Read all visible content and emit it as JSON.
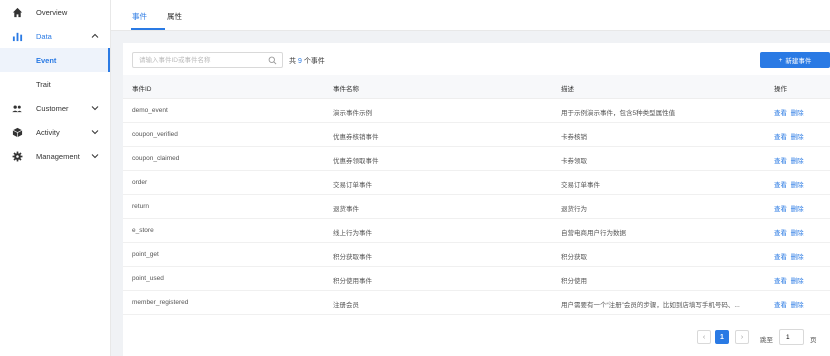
{
  "sidebar": {
    "items": [
      {
        "label": "Overview",
        "icon": "home-icon"
      },
      {
        "label": "Data",
        "icon": "bar-chart-icon",
        "expanded": true,
        "children": [
          {
            "label": "Event",
            "active": true
          },
          {
            "label": "Trait"
          }
        ]
      },
      {
        "label": "Customer",
        "icon": "users-icon"
      },
      {
        "label": "Activity",
        "icon": "cube-icon"
      },
      {
        "label": "Management",
        "icon": "gear-icon"
      }
    ]
  },
  "tabs": [
    {
      "label": "事件",
      "active": true
    },
    {
      "label": "属性"
    }
  ],
  "toolbar": {
    "search_placeholder": "请输入事件ID或事件名称",
    "count_prefix": "共",
    "count_value": "9",
    "count_suffix": "个事件",
    "new_button": "新建事件"
  },
  "table": {
    "headers": [
      "事件ID",
      "事件名称",
      "描述",
      "操作"
    ],
    "rows": [
      {
        "id": "demo_event",
        "name": "演示事件示例",
        "desc": "用于示例演示事件，包含5种类型属性值"
      },
      {
        "id": "coupon_verified",
        "name": "优惠券核销事件",
        "desc": "卡券核销"
      },
      {
        "id": "coupon_claimed",
        "name": "优惠券领取事件",
        "desc": "卡券领取"
      },
      {
        "id": "order",
        "name": "交易订单事件",
        "desc": "交易订单事件"
      },
      {
        "id": "return",
        "name": "退货事件",
        "desc": "退货行为"
      },
      {
        "id": "e_store",
        "name": "线上行为事件",
        "desc": "自营电商用户行为数据"
      },
      {
        "id": "point_get",
        "name": "积分获取事件",
        "desc": "积分获取"
      },
      {
        "id": "point_used",
        "name": "积分使用事件",
        "desc": "积分使用"
      },
      {
        "id": "member_registered",
        "name": "注册会员",
        "desc": "用户需要有一个“注册”会员的步骤，比如到店填写手机号码、..."
      }
    ],
    "actions": {
      "view": "查看",
      "delete": "删除"
    }
  },
  "pagination": {
    "prev": "‹",
    "current": "1",
    "next": "›",
    "goto_label": "跳至",
    "goto_value": "1",
    "page_unit": "页"
  },
  "colors": {
    "accent": "#2a7ae4"
  }
}
